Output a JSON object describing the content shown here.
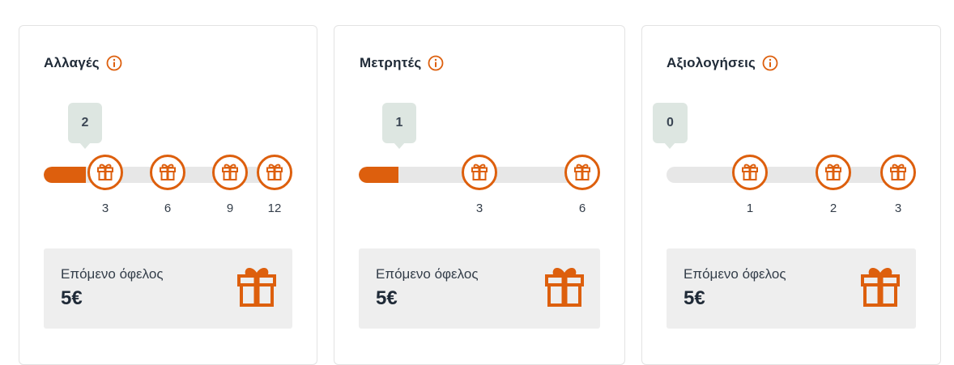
{
  "accent_color": "#dd5f0d",
  "cards": [
    {
      "title": "Αλλαγές",
      "current": "2",
      "progress_fraction": 0.17,
      "milestones": [
        "3",
        "6",
        "9",
        "12"
      ],
      "benefit_label": "Επόμενο όφελος",
      "benefit_value": "5€",
      "info_icon": "info-icon",
      "milestone_icon": "gift-icon"
    },
    {
      "title": "Μετρητές",
      "current": "1",
      "progress_fraction": 0.17,
      "milestones": [
        "3",
        "6"
      ],
      "benefit_label": "Επόμενο όφελος",
      "benefit_value": "5€",
      "info_icon": "info-icon",
      "milestone_icon": "gift-icon"
    },
    {
      "title": "Αξιολογήσεις",
      "current": "0",
      "progress_fraction": 0,
      "milestones": [
        "1",
        "2",
        "3"
      ],
      "benefit_label": "Επόμενο όφελος",
      "benefit_value": "5€",
      "info_icon": "info-icon",
      "milestone_icon": "gift-icon"
    }
  ]
}
